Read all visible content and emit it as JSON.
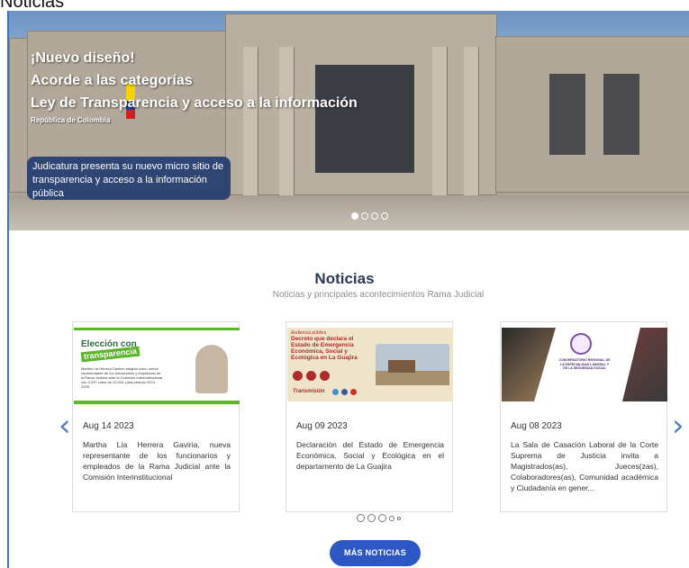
{
  "top_label": "Noticias",
  "hero": {
    "line1": "¡Nuevo diseño!",
    "line2": "Acorde a las categorías",
    "line3": "Ley de Transparencia y acceso a la información",
    "small": "República de Colombia",
    "box_text": "Judicatura presenta su nuevo micro sitio de transparencia y acceso a la información pública",
    "dots_count": 4,
    "active_dot": 0
  },
  "section": {
    "title": "Noticias",
    "subtitle": "Noticias y principales acontecimientos Rama Judicial"
  },
  "cards": [
    {
      "date": "Aug 14 2023",
      "text": "Martha Lía Herrera Gaviria, nueva representante de los funcionarios y empleados de la Rama Judicial ante la Comisión Interinstitucional",
      "img": {
        "title_line1": "Elección con",
        "title_line2": "transparencia",
        "caption": "Martha Lía Herrera Gaviria, elegida como nueva representante de los funcionarios y empleados de la Rama Judicial ante la Comisión Interinstitucional con 3.037 votos de 10.004, para periodo 2023 - 2025."
      }
    },
    {
      "date": "Aug 09 2023",
      "text": "Declaración del Estado de Emergencia Económica, Social y Ecológica en el departamento de La Guajira",
      "img": {
        "kicker": "Audiencia pública",
        "title": "Decreto que declara el Estado de Emergencia Económica, Social y Ecológica en La Guajira",
        "label": "Transmisión"
      }
    },
    {
      "date": "Aug 08 2023",
      "text": "La Sala de Casación Laboral de la Corte Suprema de Justicia invita a Magistrados(as), Jueces(zas), Colaboradores(as), Comunidad académica y Ciudadanía en gener...",
      "img": {
        "title": "CONVERSATORIO REGIONAL DE LA ESPECIALIDAD LABORAL Y DE LA SEGURIDAD SOCIAL"
      }
    }
  ],
  "carousel": {
    "prev": "‹",
    "next": "›"
  },
  "more_button": "MÁS NOTICIAS",
  "colors": {
    "accent": "#2c57c5",
    "arrow": "#4e7fc1",
    "title": "#2b3a55",
    "hero_box": "#1c376e"
  }
}
